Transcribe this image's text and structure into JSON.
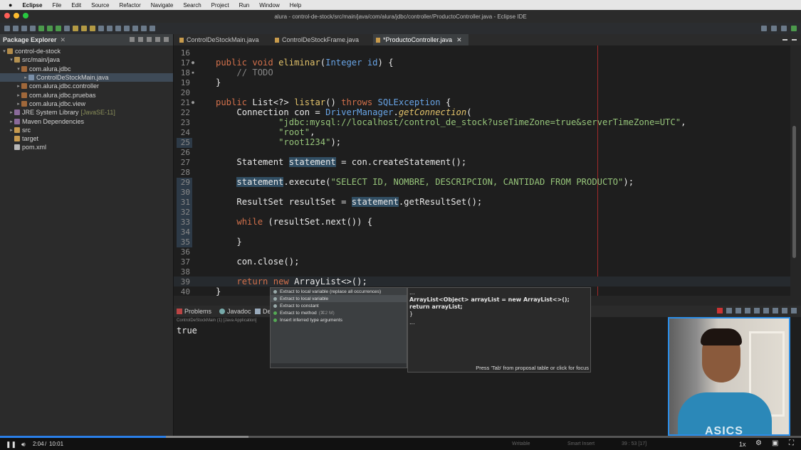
{
  "menubar": {
    "app": "Eclipse",
    "items": [
      "File",
      "Edit",
      "Source",
      "Refactor",
      "Navigate",
      "Search",
      "Project",
      "Run",
      "Window",
      "Help"
    ]
  },
  "window_title": "alura - control-de-stock/src/main/java/com/alura/jdbc/controller/ProductoController.java - Eclipse IDE",
  "package_explorer": {
    "title": "Package Explorer",
    "tree": [
      {
        "label": "control-de-stock",
        "icon": "project-icon"
      },
      {
        "label": "src/main/java",
        "icon": "source-folder-icon"
      },
      {
        "label": "com.alura.jdbc",
        "icon": "package-icon"
      },
      {
        "label": "ControlDeStockMain.java",
        "icon": "java-file-icon"
      },
      {
        "label": "com.alura.jdbc.controller",
        "icon": "package-icon"
      },
      {
        "label": "com.alura.jdbc.pruebas",
        "icon": "package-icon"
      },
      {
        "label": "com.alura.jdbc.view",
        "icon": "package-icon"
      },
      {
        "label": "JRE System Library",
        "extra": "[JavaSE-11]",
        "icon": "library-icon"
      },
      {
        "label": "Maven Dependencies",
        "icon": "library-icon"
      },
      {
        "label": "src",
        "icon": "folder-icon"
      },
      {
        "label": "target",
        "icon": "folder-icon"
      },
      {
        "label": "pom.xml",
        "icon": "xml-file-icon"
      }
    ]
  },
  "editor_tabs": [
    {
      "label": "ControlDeStockMain.java"
    },
    {
      "label": "ControlDeStockFrame.java"
    },
    {
      "label": "*ProductoController.java",
      "close": "✕"
    }
  ],
  "code": {
    "lines": [
      "16",
      "17",
      "18",
      "19",
      "20",
      "21",
      "22",
      "23",
      "24",
      "25",
      "26",
      "27",
      "28",
      "29",
      "30",
      "31",
      "32",
      "33",
      "34",
      "35",
      "36",
      "37",
      "38",
      "39",
      "40"
    ]
  },
  "bottom_panel": {
    "tabs": [
      "Problems",
      "Javadoc",
      "De"
    ],
    "launch": "ControlDeStockMain (1) [Java Application]",
    "output": "true"
  },
  "quick_fix": {
    "items": [
      {
        "label": "Extract to local variable (replace all occurrences)"
      },
      {
        "label": "Extract to local variable"
      },
      {
        "label": "Extract to constant"
      },
      {
        "label": "Extract to method",
        "shortcut": "(⌘2 M)"
      },
      {
        "label": "Insert inferred type arguments"
      }
    ],
    "preview_line1": "...",
    "preview_line2": "ArrayList<Object> arrayList = new ArrayList<>();",
    "preview_line3": "return arrayList;",
    "preview_line4": "}",
    "preview_line5": "...",
    "hint": "Press 'Tab' from proposal table or click for focus"
  },
  "player": {
    "time": "2:04",
    "sep": "/",
    "duration": "10:01",
    "speed": "1x",
    "progress": 0.207,
    "buffered": 0.31,
    "status_writable": "Writable",
    "status_insert": "Smart Insert",
    "status_pos": "39 : 53 [17]"
  }
}
